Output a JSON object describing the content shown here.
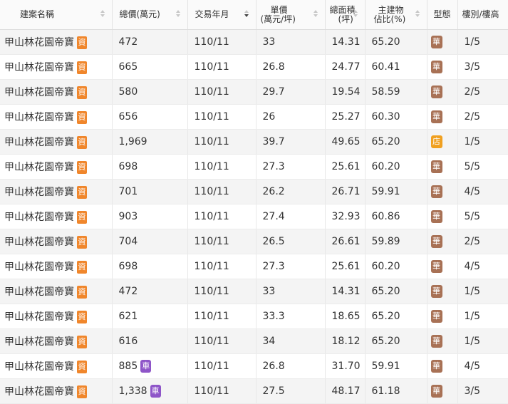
{
  "headers": {
    "name": "建案名稱",
    "total_price": "總價(萬元)",
    "date": "交易年月",
    "unit_price_1": "單價",
    "unit_price_2": "(萬元/坪)",
    "area_1": "總面積",
    "area_2": "(坪)",
    "main_1": "主建物",
    "main_2": "佔比(%)",
    "type": "型態",
    "floor": "樓別/樓高"
  },
  "colors": {
    "tag_capital": "#f0862b",
    "tag_car": "#8e55c8",
    "type_hua": "#a87155",
    "type_shop": "#f0a020"
  },
  "tag_capital_label": "資",
  "tag_car_label": "車",
  "rows": [
    {
      "name": "甲山林花園帝寶",
      "price": "472",
      "date": "110/11",
      "unit": "33",
      "area": "14.31",
      "main": "65.20",
      "type": "華",
      "floor": "1/5",
      "car": false
    },
    {
      "name": "甲山林花園帝寶",
      "price": "665",
      "date": "110/11",
      "unit": "26.8",
      "area": "24.77",
      "main": "60.41",
      "type": "華",
      "floor": "3/5",
      "car": false
    },
    {
      "name": "甲山林花園帝寶",
      "price": "580",
      "date": "110/11",
      "unit": "29.7",
      "area": "19.54",
      "main": "58.59",
      "type": "華",
      "floor": "2/5",
      "car": false
    },
    {
      "name": "甲山林花園帝寶",
      "price": "656",
      "date": "110/11",
      "unit": "26",
      "area": "25.27",
      "main": "60.30",
      "type": "華",
      "floor": "2/5",
      "car": false
    },
    {
      "name": "甲山林花園帝寶",
      "price": "1,969",
      "date": "110/11",
      "unit": "39.7",
      "area": "49.65",
      "main": "65.20",
      "type": "店",
      "floor": "1/5",
      "car": false
    },
    {
      "name": "甲山林花園帝寶",
      "price": "698",
      "date": "110/11",
      "unit": "27.3",
      "area": "25.61",
      "main": "60.20",
      "type": "華",
      "floor": "5/5",
      "car": false
    },
    {
      "name": "甲山林花園帝寶",
      "price": "701",
      "date": "110/11",
      "unit": "26.2",
      "area": "26.71",
      "main": "59.91",
      "type": "華",
      "floor": "4/5",
      "car": false
    },
    {
      "name": "甲山林花園帝寶",
      "price": "903",
      "date": "110/11",
      "unit": "27.4",
      "area": "32.93",
      "main": "60.86",
      "type": "華",
      "floor": "5/5",
      "car": false
    },
    {
      "name": "甲山林花園帝寶",
      "price": "704",
      "date": "110/11",
      "unit": "26.5",
      "area": "26.61",
      "main": "59.89",
      "type": "華",
      "floor": "2/5",
      "car": false
    },
    {
      "name": "甲山林花園帝寶",
      "price": "698",
      "date": "110/11",
      "unit": "27.3",
      "area": "25.61",
      "main": "60.20",
      "type": "華",
      "floor": "4/5",
      "car": false
    },
    {
      "name": "甲山林花園帝寶",
      "price": "472",
      "date": "110/11",
      "unit": "33",
      "area": "14.31",
      "main": "65.20",
      "type": "華",
      "floor": "1/5",
      "car": false
    },
    {
      "name": "甲山林花園帝寶",
      "price": "621",
      "date": "110/11",
      "unit": "33.3",
      "area": "18.65",
      "main": "65.20",
      "type": "華",
      "floor": "1/5",
      "car": false
    },
    {
      "name": "甲山林花園帝寶",
      "price": "616",
      "date": "110/11",
      "unit": "34",
      "area": "18.12",
      "main": "65.20",
      "type": "華",
      "floor": "1/5",
      "car": false
    },
    {
      "name": "甲山林花園帝寶",
      "price": "885",
      "date": "110/11",
      "unit": "26.8",
      "area": "31.70",
      "main": "59.91",
      "type": "華",
      "floor": "4/5",
      "car": true
    },
    {
      "name": "甲山林花園帝寶",
      "price": "1,338",
      "date": "110/11",
      "unit": "27.5",
      "area": "48.17",
      "main": "61.18",
      "type": "華",
      "floor": "3/5",
      "car": true
    }
  ]
}
